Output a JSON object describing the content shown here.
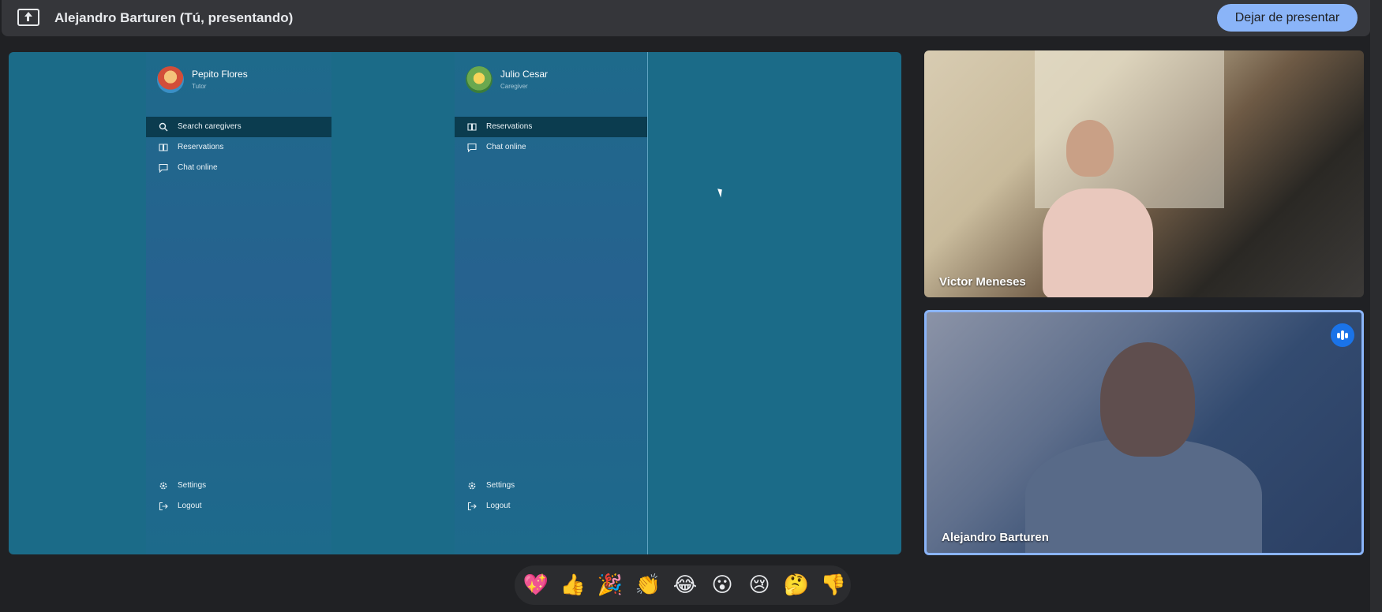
{
  "topbar": {
    "presenter_title": "Alejandro Barturen (Tú, presentando)",
    "stop_presenting_label": "Dejar de presentar",
    "icon": "present-to-all-icon",
    "button_color": "#8ab4f8"
  },
  "shared_screen": {
    "background_color": "#1b6b88",
    "panels": [
      {
        "profile": {
          "name": "Pepito Flores",
          "role": "Tutor"
        },
        "menu": [
          {
            "label": "Search caregivers",
            "icon": "search-icon",
            "active": true
          },
          {
            "label": "Reservations",
            "icon": "book-icon",
            "active": false
          },
          {
            "label": "Chat online",
            "icon": "chat-icon",
            "active": false
          }
        ],
        "footer": [
          {
            "label": "Settings",
            "icon": "gear-icon"
          },
          {
            "label": "Logout",
            "icon": "logout-icon"
          }
        ]
      },
      {
        "profile": {
          "name": "Julio Cesar",
          "role": "Caregiver"
        },
        "menu": [
          {
            "label": "Reservations",
            "icon": "book-icon",
            "active": true
          },
          {
            "label": "Chat online",
            "icon": "chat-icon",
            "active": false
          }
        ],
        "footer": [
          {
            "label": "Settings",
            "icon": "gear-icon"
          },
          {
            "label": "Logout",
            "icon": "logout-icon"
          }
        ]
      }
    ]
  },
  "participants": [
    {
      "name": "Victor Meneses",
      "speaking": false
    },
    {
      "name": "Alejandro Barturen",
      "speaking": true,
      "highlight_color": "#8ab4f8"
    }
  ],
  "reactions": [
    "💖",
    "👍",
    "🎉",
    "👏",
    "😂",
    "😮",
    "😢",
    "🤔",
    "👎"
  ]
}
